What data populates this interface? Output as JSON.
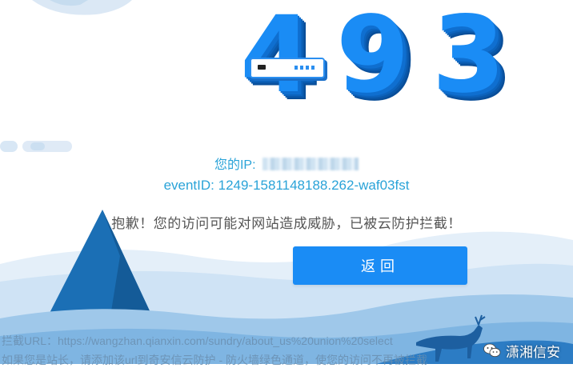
{
  "error": {
    "code": "493"
  },
  "info": {
    "ip_label": "您的IP:",
    "ip_value": "",
    "event_label": "eventID: ",
    "event_value": "1249-1581148188.262-waf03fst",
    "warning": "抱歉！您的访问可能对网站造成威胁，已被云防护拦截！"
  },
  "actions": {
    "back_label": "返回"
  },
  "footer": {
    "block_url": "拦截URL：https://wangzhan.qianxin.com/sundry/about_us%20union%20select",
    "owner_tip": "如果您是站长，请添加该url到奇安信云防护 - 防火墙绿色通道，使您的访问不再被拦截"
  },
  "watermark": {
    "text": "潇湘信安",
    "icon": "wechat-icon"
  },
  "colors": {
    "accent": "#1a8cf5",
    "info_text": "#2aa3d8",
    "warning_text": "#555555"
  }
}
